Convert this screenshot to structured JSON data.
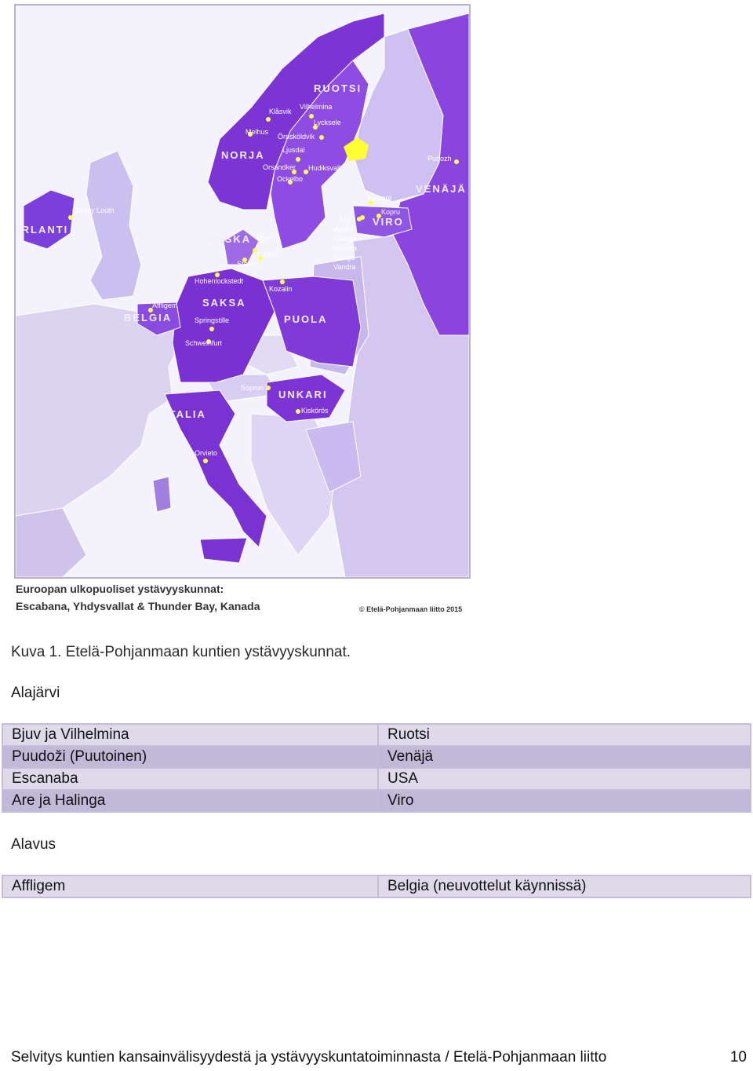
{
  "map": {
    "country_labels": [
      "RUOTSI",
      "NORJA",
      "VENÄJÄ",
      "IRLANTI",
      "TANSKA",
      "VIRO",
      "SAKSA",
      "BELGIA",
      "PUOLA",
      "UNKARI",
      "ITALIA"
    ],
    "cities": [
      "Klåsvik",
      "Vilhelmina",
      "Lycksele",
      "Melhus",
      "Örnsköldvik",
      "Ljusdal",
      "Orsandker",
      "Hudiksvall",
      "Ockelbo",
      "Pudozh",
      "County Louth",
      "Bjuv",
      "Stevns",
      "Höör",
      "Ilakvere",
      "Kopru",
      "Are",
      "Audru",
      "Halinga",
      "Koonga",
      "Sauga",
      "Vandra",
      "Hohenlockstedt",
      "Kozalin",
      "Affligem",
      "Springstille",
      "Schweinfurt",
      "Sopron",
      "Kiskörös",
      "Orvieto"
    ],
    "footnote_line1": "Euroopan ulkopuoliset ystävyyskunnat:",
    "footnote_line2": "Escabana, Yhdysvallat & Thunder Bay, Kanada",
    "copyright": "© Etelä-Pohjanmaan liitto 2015",
    "colors": {
      "highlight": "#7a2fd6",
      "secondary": "#a07fe0",
      "light": "#dcd3f1",
      "finland_region": "#ffff33",
      "city_dot": "#ffff55"
    }
  },
  "caption": "Kuva 1. Etelä-Pohjanmaan kuntien ystävyyskunnat.",
  "sections": [
    {
      "title": "Alajärvi",
      "rows": [
        {
          "municipality": "Bjuv ja Vilhelmina",
          "country": "Ruotsi"
        },
        {
          "municipality": "Puudoži (Puutoinen)",
          "country": "Venäjä"
        },
        {
          "municipality": "Escanaba",
          "country": "USA"
        },
        {
          "municipality": "Are ja Halinga",
          "country": "Viro"
        }
      ]
    },
    {
      "title": "Alavus",
      "rows": [
        {
          "municipality": "Affligem",
          "country": "Belgia (neuvottelut käynnissä)"
        }
      ]
    }
  ],
  "footer": "Selvitys kuntien kansainvälisyydestä ja ystävyyskuntatoiminnasta / Etelä-Pohjanmaan liitto",
  "page_number": "10"
}
